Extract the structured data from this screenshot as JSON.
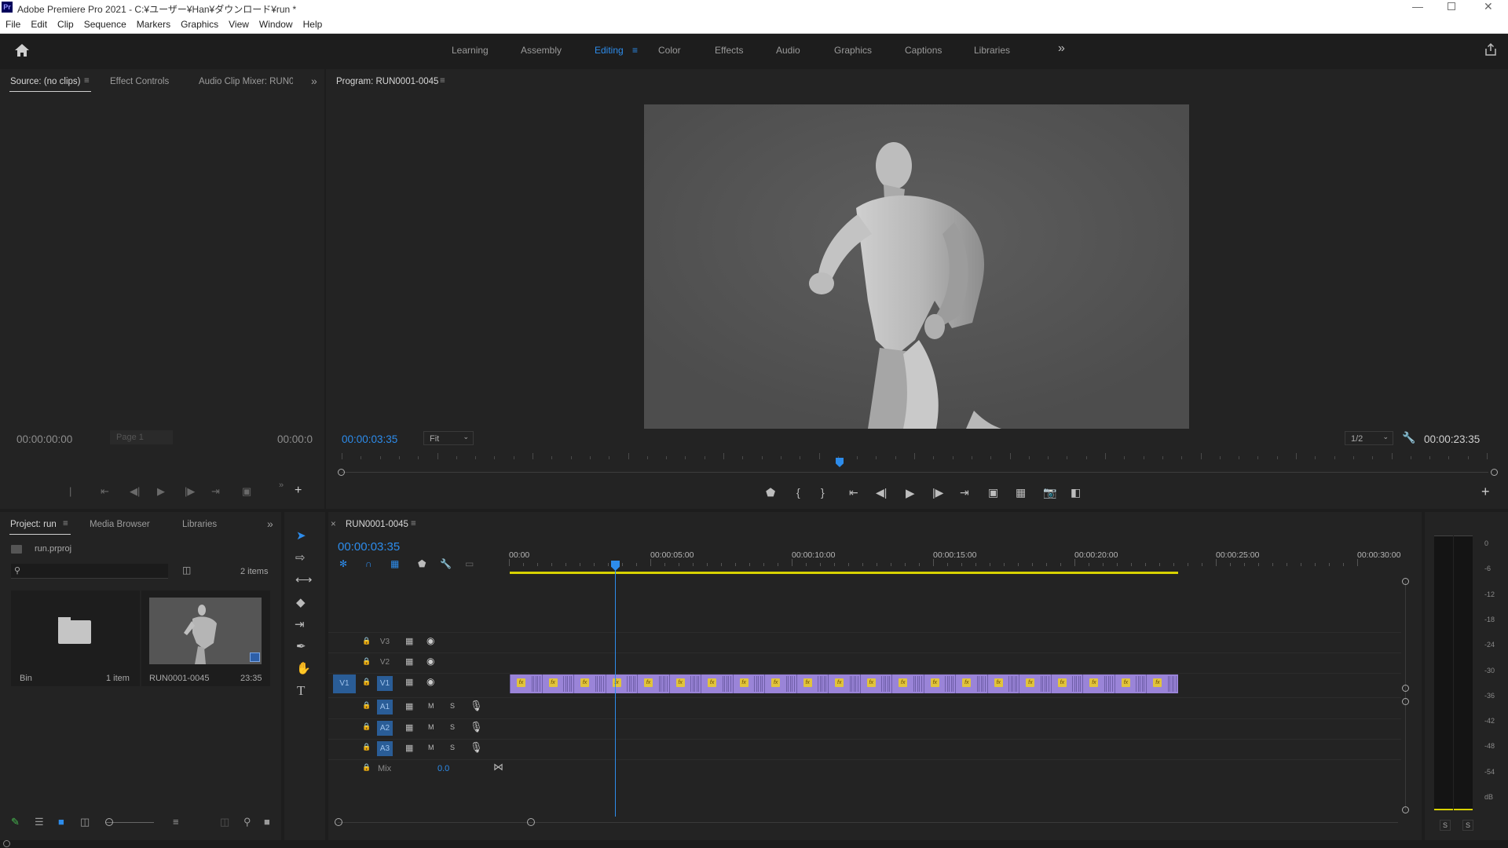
{
  "window": {
    "title": "Adobe Premiere Pro 2021 - C:¥ユーザー¥Han¥ダウンロード¥run *",
    "app_icon": "Pr"
  },
  "menu": [
    "File",
    "Edit",
    "Clip",
    "Sequence",
    "Markers",
    "Graphics",
    "View",
    "Window",
    "Help"
  ],
  "workspaces": {
    "items": [
      "Learning",
      "Assembly",
      "Editing",
      "Color",
      "Effects",
      "Audio",
      "Graphics",
      "Captions",
      "Libraries"
    ],
    "active": "Editing",
    "more": "»"
  },
  "source": {
    "tabs": [
      "Source: (no clips)",
      "Effect Controls",
      "Audio Clip Mixer: RUN0("
    ],
    "timecode_in": "00:00:00:00",
    "timecode_out": "00:00:0",
    "page": "Page 1"
  },
  "program": {
    "tab": "Program: RUN0001-0045",
    "timecode": "00:00:03:35",
    "fit": "Fit",
    "resolution": "1/2",
    "duration": "00:00:23:35",
    "playhead_fraction": 0.15
  },
  "project": {
    "tabs": [
      "Project: run",
      "Media Browser",
      "Libraries"
    ],
    "file": "run.prproj",
    "count": "2 items",
    "items": [
      {
        "name": "Bin",
        "meta": "1 item"
      },
      {
        "name": "RUN0001-0045",
        "meta": "23:35"
      }
    ]
  },
  "timeline": {
    "tab": "RUN0001-0045",
    "timecode": "00:00:03:35",
    "ruler": [
      "00:00",
      "00:00:05:00",
      "00:00:10:00",
      "00:00:15:00",
      "00:00:20:00",
      "00:00:25:00",
      "00:00:30:00"
    ],
    "video_tracks": [
      "V3",
      "V2",
      "V1"
    ],
    "audio_tracks": [
      "A1",
      "A2",
      "A3"
    ],
    "source_patch": "V1",
    "mix_label": "Mix",
    "mix_value": "0.0",
    "m": "M",
    "s": "S",
    "clip_count": 21,
    "clip_fx": "fx"
  },
  "meter": {
    "scale": [
      "0",
      "-6",
      "-12",
      "-18",
      "-24",
      "-30",
      "-36",
      "-42",
      "-48",
      "-54",
      "dB"
    ],
    "solo": [
      "S",
      "S"
    ]
  },
  "colors": {
    "accent": "#2d8ceb",
    "clip": "#9a84d8",
    "workarea": "#d8d200"
  }
}
